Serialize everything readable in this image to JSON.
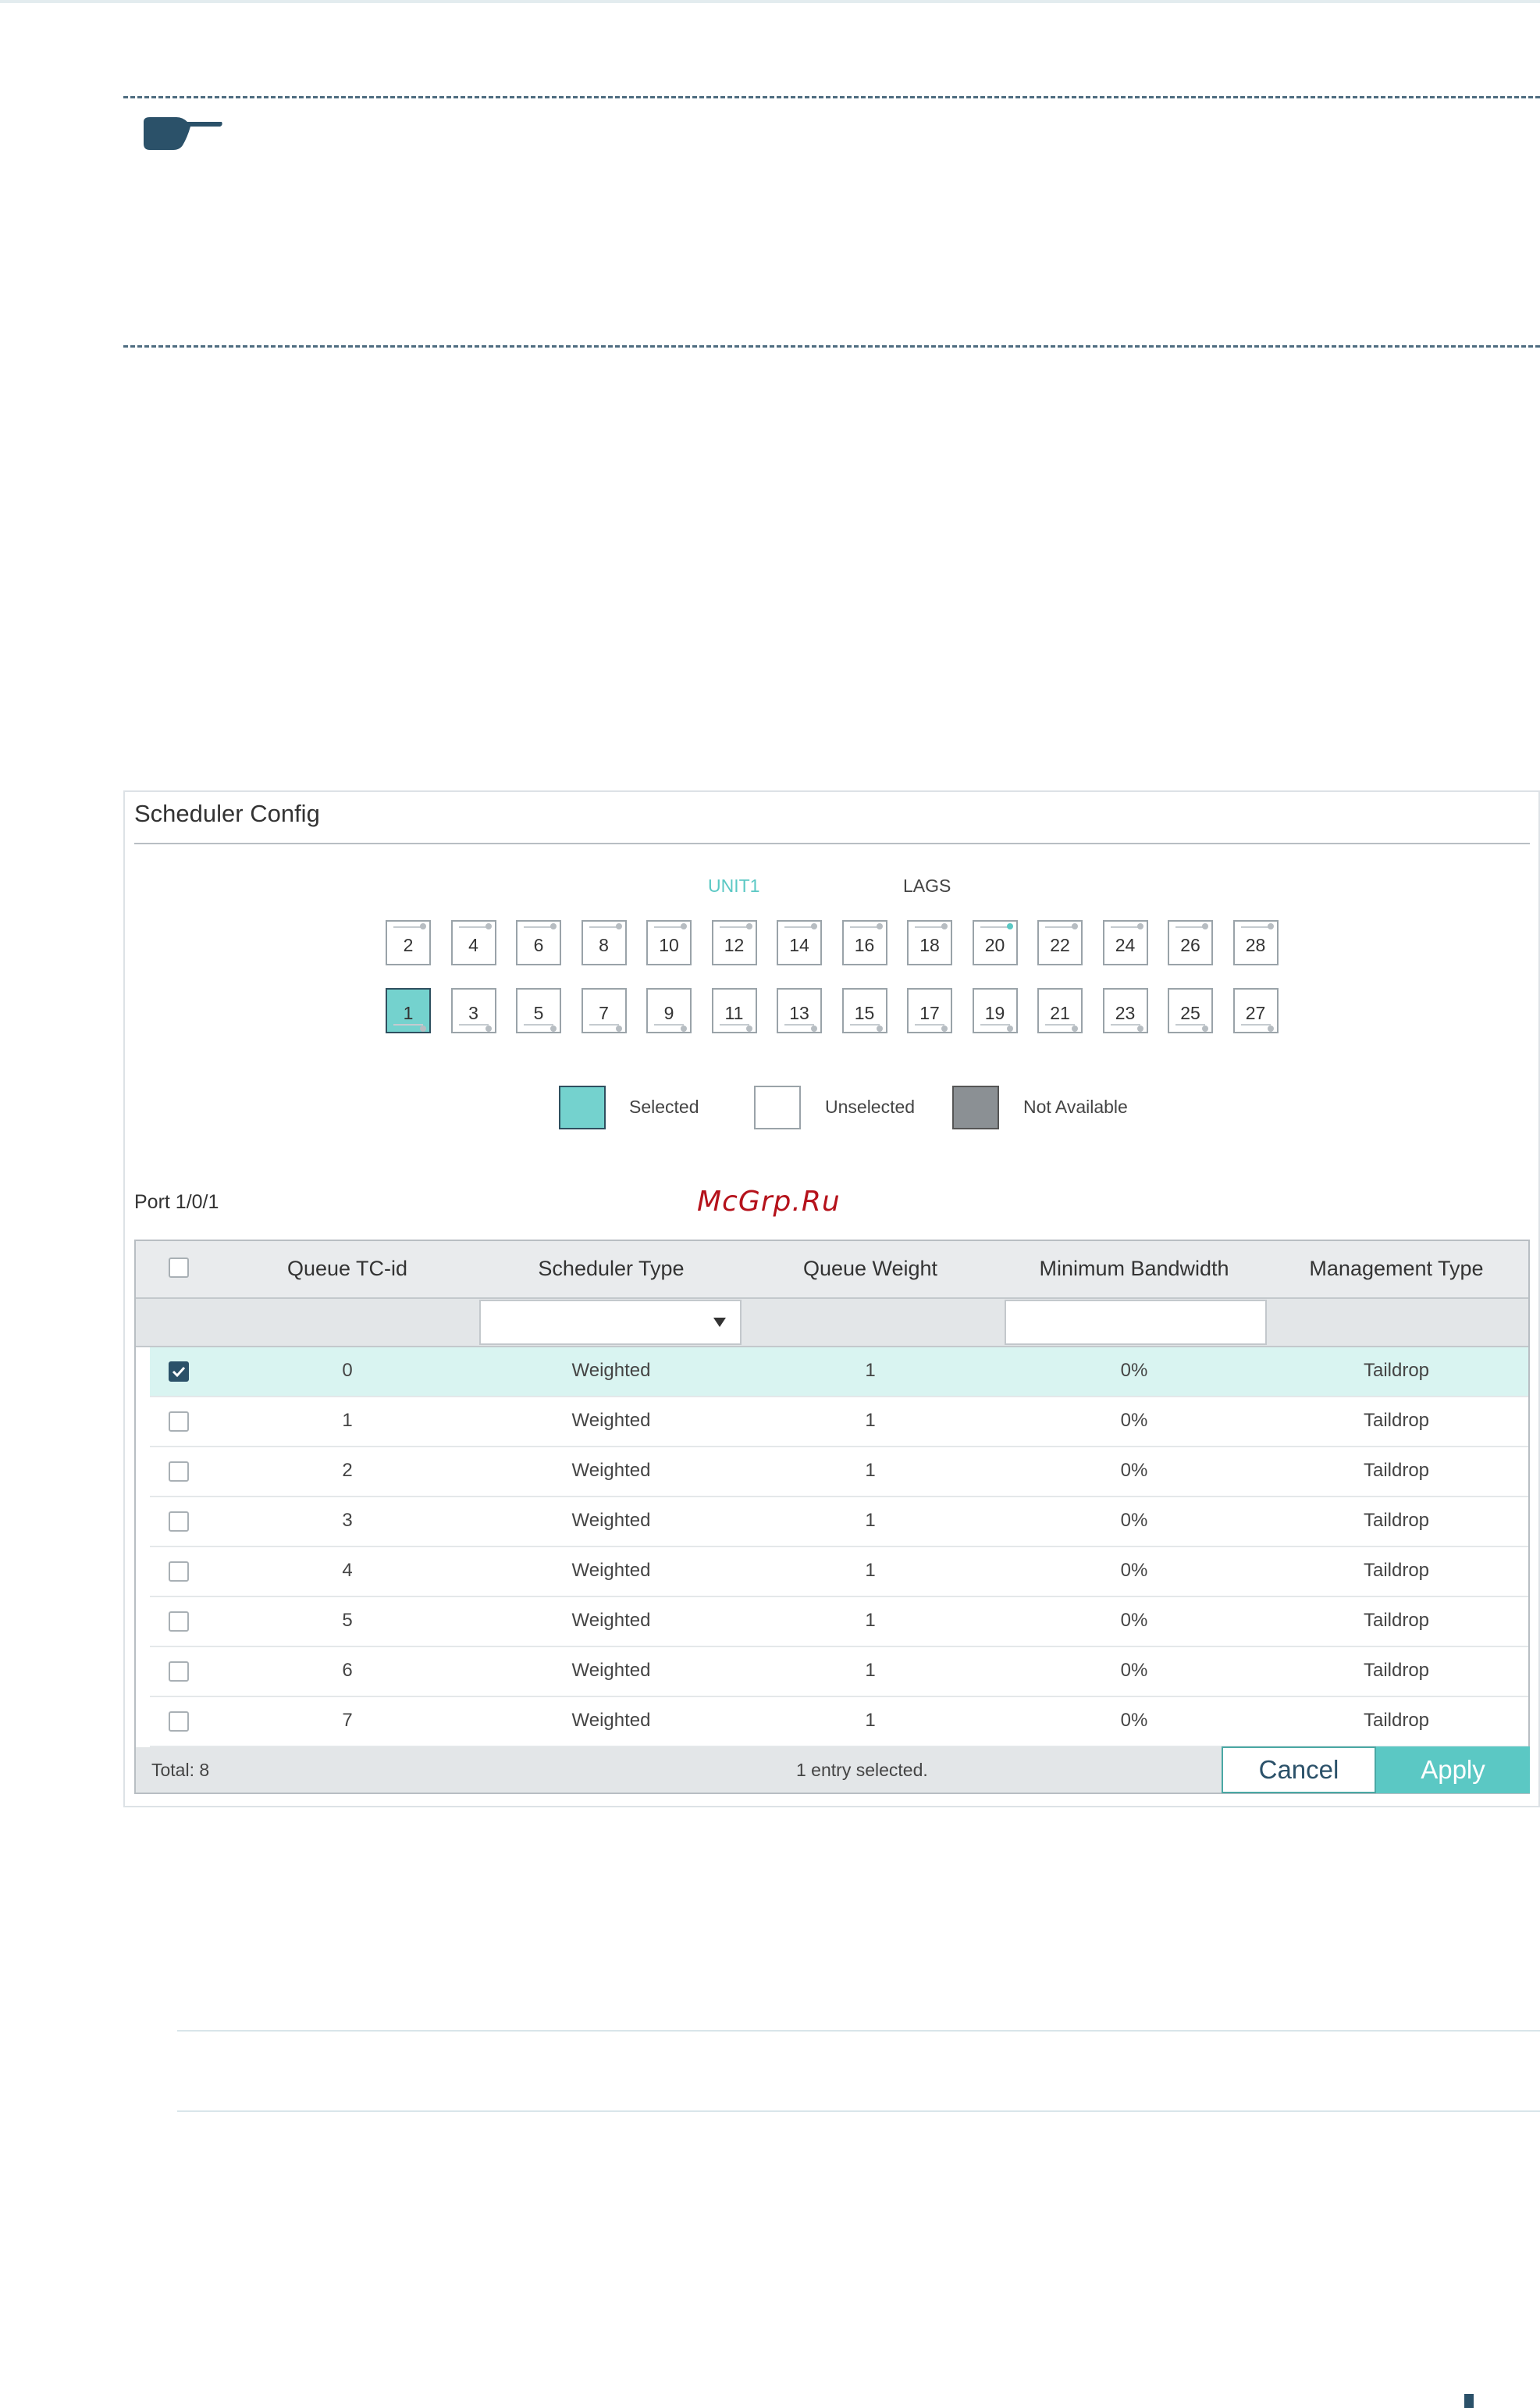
{
  "panel": {
    "title": "Scheduler Config",
    "unit_label": "UNIT1",
    "lags_label": "LAGS"
  },
  "ports": {
    "top_row": [
      "2",
      "4",
      "6",
      "8",
      "10",
      "12",
      "14",
      "16",
      "18",
      "20",
      "22",
      "24",
      "26",
      "28"
    ],
    "bottom_row": [
      "1",
      "3",
      "5",
      "7",
      "9",
      "11",
      "13",
      "15",
      "17",
      "19",
      "21",
      "23",
      "25",
      "27"
    ],
    "selected": "1",
    "active_led": "20"
  },
  "legend": {
    "selected": "Selected",
    "unselected": "Unselected",
    "not_available": "Not Available"
  },
  "port_label": "Port 1/0/1",
  "watermark": "McGrp.Ru",
  "table": {
    "columns": [
      "Queue TC-id",
      "Scheduler Type",
      "Queue Weight",
      "Minimum Bandwidth",
      "Management Type"
    ],
    "rows": [
      {
        "id": "0",
        "type": "Weighted",
        "weight": "1",
        "bandwidth": "0%",
        "mgmt": "Taildrop",
        "checked": true
      },
      {
        "id": "1",
        "type": "Weighted",
        "weight": "1",
        "bandwidth": "0%",
        "mgmt": "Taildrop",
        "checked": false
      },
      {
        "id": "2",
        "type": "Weighted",
        "weight": "1",
        "bandwidth": "0%",
        "mgmt": "Taildrop",
        "checked": false
      },
      {
        "id": "3",
        "type": "Weighted",
        "weight": "1",
        "bandwidth": "0%",
        "mgmt": "Taildrop",
        "checked": false
      },
      {
        "id": "4",
        "type": "Weighted",
        "weight": "1",
        "bandwidth": "0%",
        "mgmt": "Taildrop",
        "checked": false
      },
      {
        "id": "5",
        "type": "Weighted",
        "weight": "1",
        "bandwidth": "0%",
        "mgmt": "Taildrop",
        "checked": false
      },
      {
        "id": "6",
        "type": "Weighted",
        "weight": "1",
        "bandwidth": "0%",
        "mgmt": "Taildrop",
        "checked": false
      },
      {
        "id": "7",
        "type": "Weighted",
        "weight": "1",
        "bandwidth": "0%",
        "mgmt": "Taildrop",
        "checked": false
      }
    ],
    "total": "Total: 8",
    "selection_status": "1 entry selected."
  },
  "buttons": {
    "cancel": "Cancel",
    "apply": "Apply"
  },
  "icons": [
    "pointing-hand-icon",
    "port-icon",
    "checkbox-icon",
    "dropdown-arrow-icon"
  ],
  "colors": {
    "accent": "#5bc8c4",
    "selected_row": "#d9f4f1",
    "checkbox_on": "#2b5169"
  }
}
